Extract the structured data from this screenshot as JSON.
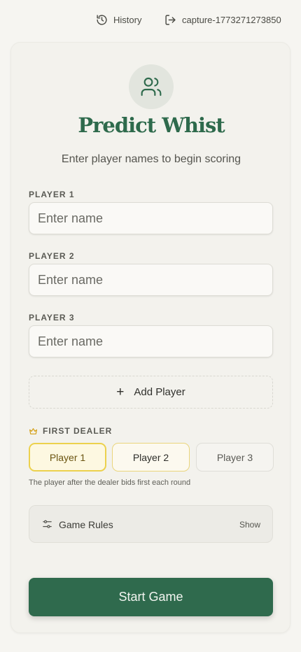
{
  "topbar": {
    "history_label": "History",
    "history_icon": "history-icon",
    "session_label": "capture-1773271273850",
    "session_icon": "logout-icon"
  },
  "header": {
    "logo_icon": "users-icon",
    "title": "Predict Whist",
    "subtitle": "Enter player names to begin scoring"
  },
  "players": [
    {
      "label": "PLAYER 1",
      "value": "",
      "placeholder": "Enter name"
    },
    {
      "label": "PLAYER 2",
      "value": "",
      "placeholder": "Enter name"
    },
    {
      "label": "PLAYER 3",
      "value": "",
      "placeholder": "Enter name"
    }
  ],
  "add_player": {
    "icon": "+",
    "label": "Add Player"
  },
  "first_dealer": {
    "icon": "crown-icon",
    "label": "FIRST DEALER",
    "options": [
      "Player 1",
      "Player 2",
      "Player 3"
    ],
    "selected": "Player 1",
    "hint": "The player after the dealer bids first each round"
  },
  "game_rules": {
    "icon": "sliders-icon",
    "label": "Game Rules",
    "toggle_label": "Show"
  },
  "start_button": {
    "label": "Start Game"
  },
  "colors": {
    "brand_green": "#2f6a4d",
    "dealer_selected_border": "#ecd14d",
    "background": "#f6f5f1"
  }
}
